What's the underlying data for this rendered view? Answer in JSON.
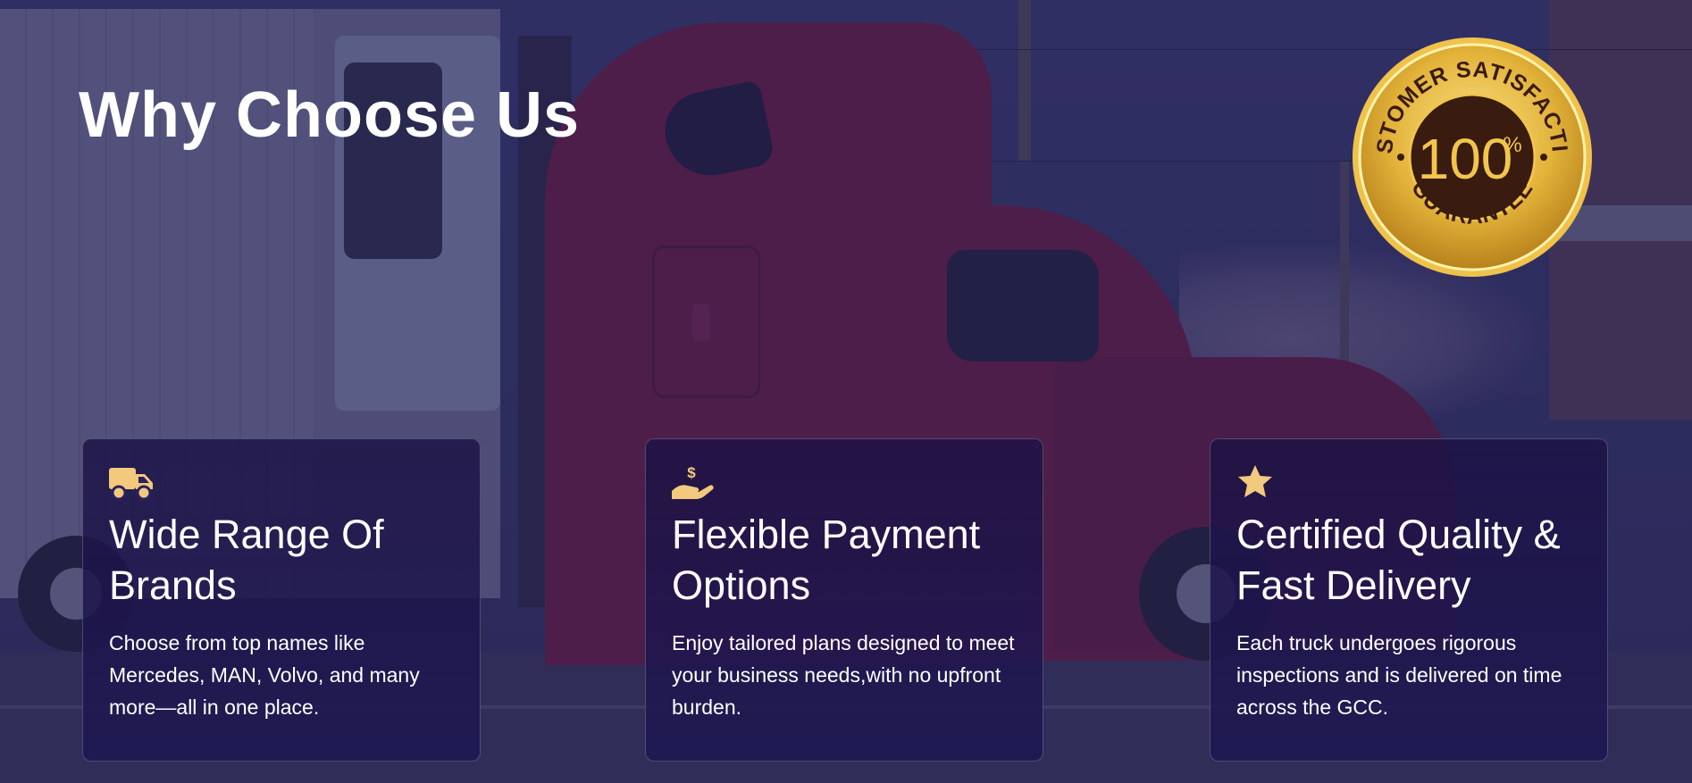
{
  "section": {
    "title": "Why Choose Us"
  },
  "badge": {
    "top_text": "CUSTOMER SATISFACTION",
    "number": "100",
    "percent": "%",
    "bottom_text": "GUARANTEE",
    "colors": {
      "ring": "#e3b33a",
      "center": "#3a1b10",
      "text": "#f2c54c"
    }
  },
  "background": {
    "description_icon": "truck-photo",
    "overlay_color": "#28265f"
  },
  "cards": [
    {
      "icon": "truck-icon",
      "title": "Wide Range Of Brands",
      "text": "Choose from top names like Mercedes, MAN, Volvo, and many more—all in one place."
    },
    {
      "icon": "hand-dollar-icon",
      "title": "Flexible Payment Options",
      "text": "Enjoy tailored plans designed to meet your business needs,with no upfront burden."
    },
    {
      "icon": "star-icon",
      "title": "Certified Quality & Fast Delivery",
      "text": "Each truck undergoes rigorous inspections and is delivered on time across the GCC."
    }
  ],
  "colors": {
    "icon_accent": "#f2c97d",
    "card_bg": "#1e1850",
    "text": "#ffffff"
  }
}
